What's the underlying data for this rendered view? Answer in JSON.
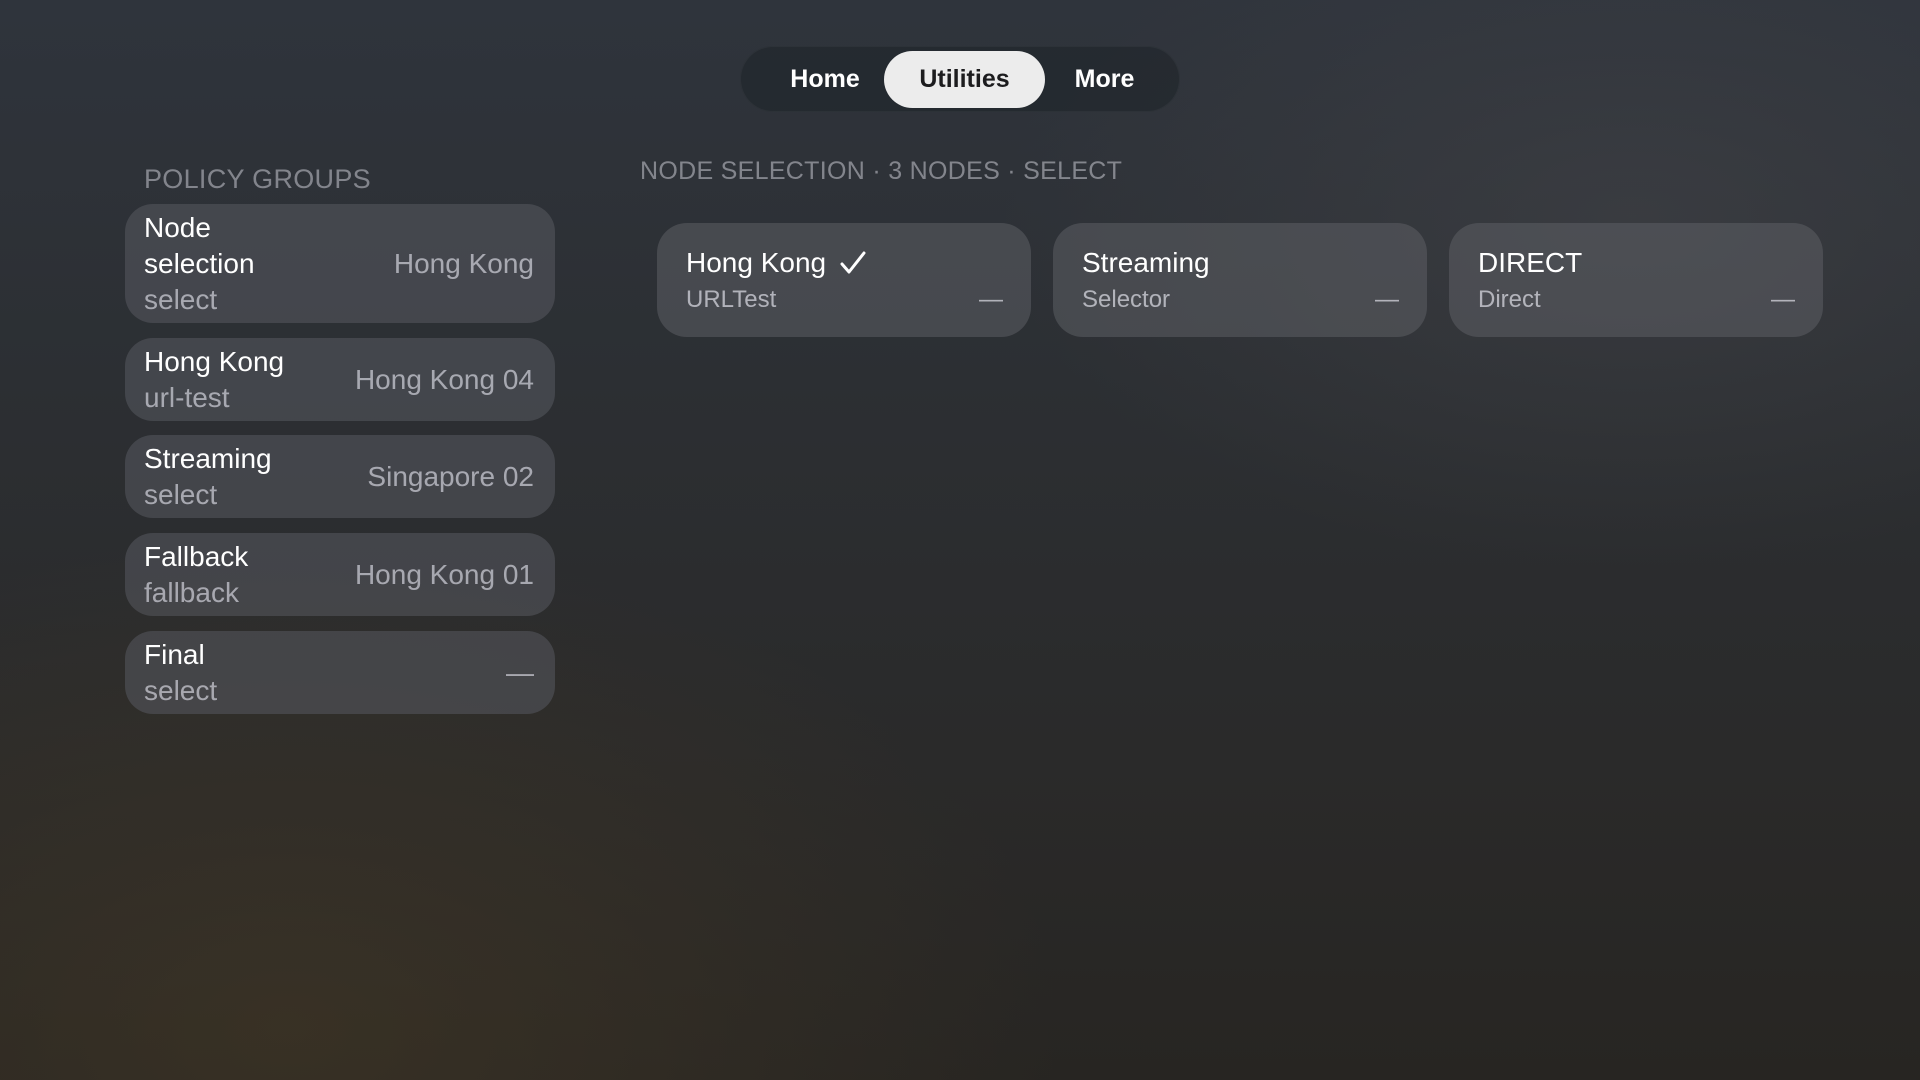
{
  "tabs": [
    {
      "label": "Home",
      "selected": false
    },
    {
      "label": "Utilities",
      "selected": true
    },
    {
      "label": "More",
      "selected": false
    }
  ],
  "policy_groups": {
    "heading": "POLICY GROUPS",
    "items": [
      {
        "name": "Node selection",
        "type": "select",
        "current": "Hong Kong"
      },
      {
        "name": "Hong Kong",
        "type": "url-test",
        "current": "Hong Kong 04"
      },
      {
        "name": "Streaming",
        "type": "select",
        "current": "Singapore 02"
      },
      {
        "name": "Fallback",
        "type": "fallback",
        "current": "Hong Kong 01"
      },
      {
        "name": "Final",
        "type": "select",
        "current": "—"
      }
    ]
  },
  "detail": {
    "heading": "NODE SELECTION · 3 NODES · SELECT",
    "nodes": [
      {
        "name": "Hong Kong",
        "kind": "URLTest",
        "latency": "—",
        "selected": true,
        "check_icon": "checkmark-icon"
      },
      {
        "name": "Streaming",
        "kind": "Selector",
        "latency": "—",
        "selected": false
      },
      {
        "name": "DIRECT",
        "kind": "Direct",
        "latency": "—",
        "selected": false
      }
    ]
  }
}
